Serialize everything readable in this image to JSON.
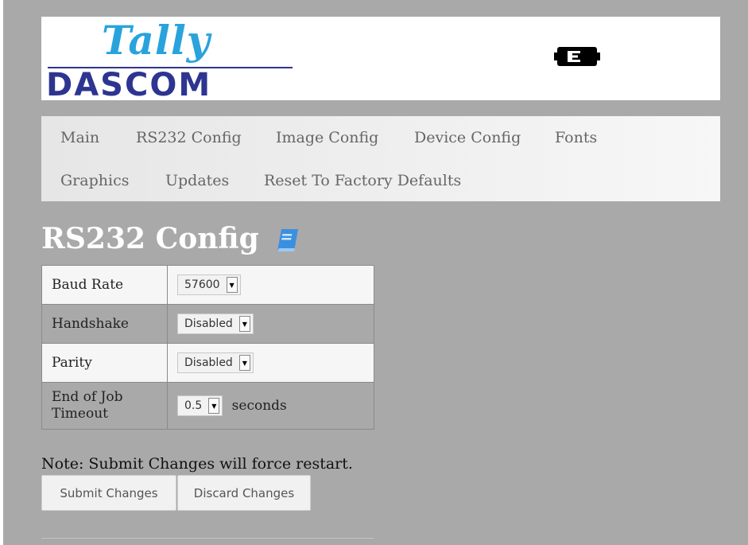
{
  "header": {
    "logo_top": "Tally",
    "logo_bottom": "DASCOM",
    "status_icon": "ethernet-icon"
  },
  "nav": {
    "items": [
      {
        "label": "Main"
      },
      {
        "label": "RS232 Config"
      },
      {
        "label": "Image Config"
      },
      {
        "label": "Device Config"
      },
      {
        "label": "Fonts"
      },
      {
        "label": "Graphics"
      },
      {
        "label": "Updates"
      },
      {
        "label": "Reset To Factory Defaults"
      }
    ]
  },
  "page": {
    "title": "RS232 Config",
    "help_icon": "book-icon"
  },
  "settings": {
    "rows": [
      {
        "label": "Baud Rate",
        "value": "57600"
      },
      {
        "label": "Handshake",
        "value": "Disabled"
      },
      {
        "label": "Parity",
        "value": "Disabled"
      },
      {
        "label": "End of Job Timeout",
        "value": "0.5",
        "unit": "seconds"
      }
    ]
  },
  "footer": {
    "note": "Note: Submit Changes will force restart.",
    "submit_label": "Submit Changes",
    "discard_label": "Discard Changes"
  },
  "colors": {
    "background": "#a9a9a9",
    "logo_blue": "#29a3dc",
    "logo_navy": "#2d3591",
    "help_icon": "#3b8fe0"
  }
}
